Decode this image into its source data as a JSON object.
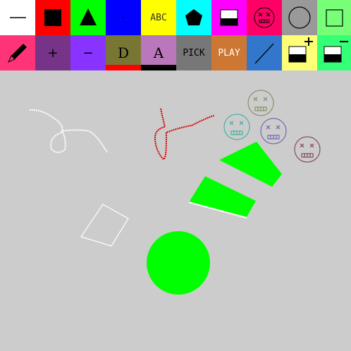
{
  "toolbar": {
    "row1": [
      {
        "name": "line-tool",
        "bg": "#ffffff"
      },
      {
        "name": "filled-square-tool",
        "bg": "#ff0000"
      },
      {
        "name": "triangle-tool",
        "bg": "#00ff00"
      },
      {
        "name": "dot-tool",
        "bg": "#0000ff",
        "label": "·"
      },
      {
        "name": "text-tool",
        "bg": "#ffff00",
        "label": "ABC"
      },
      {
        "name": "pentagon-tool",
        "bg": "#00ffff"
      },
      {
        "name": "half-fill-tool",
        "bg": "#ff00ff"
      },
      {
        "name": "face-stamp-tool",
        "bg": "#ff0066"
      },
      {
        "name": "circle-outline-tool",
        "bg": "#999999"
      },
      {
        "name": "square-outline-tool",
        "bg": "#77ff77"
      }
    ],
    "row2": [
      {
        "name": "pencil-tool",
        "bg": "#ff3377"
      },
      {
        "name": "increase-size-button",
        "bg": "#773388",
        "label": "+"
      },
      {
        "name": "decrease-size-button",
        "bg": "#8833ff",
        "label": "−"
      },
      {
        "name": "font-d-button",
        "bg": "#777733",
        "label": "D",
        "underline": "#ff0000"
      },
      {
        "name": "font-a-button",
        "bg": "#bb77bb",
        "label": "A",
        "underline": "#000000"
      },
      {
        "name": "pick-button",
        "bg": "#777777",
        "label": "PICK"
      },
      {
        "name": "play-button",
        "bg": "#cc7733",
        "label": "PLAY"
      },
      {
        "name": "slash-line-tool",
        "bg": "#3377cc"
      },
      {
        "name": "fill-plus-button",
        "bg": "#ffff77"
      },
      {
        "name": "fill-minus-button",
        "bg": "#33ff77"
      }
    ]
  },
  "colors": {
    "canvas_bg": "#cccccc",
    "green_fill": "#00ff00",
    "red_stroke": "#dd0000",
    "white_stroke": "#ffffff"
  },
  "icons": [
    "line-icon",
    "square-icon",
    "triangle-icon",
    "dot-icon",
    "abc-icon",
    "pentagon-icon",
    "half-fill-icon",
    "face-icon",
    "circle-icon",
    "square-outline-icon",
    "pencil-icon",
    "plus-icon",
    "minus-icon",
    "d-icon",
    "a-icon",
    "pick-icon",
    "play-icon",
    "slash-icon",
    "fill-plus-icon",
    "fill-minus-icon"
  ]
}
